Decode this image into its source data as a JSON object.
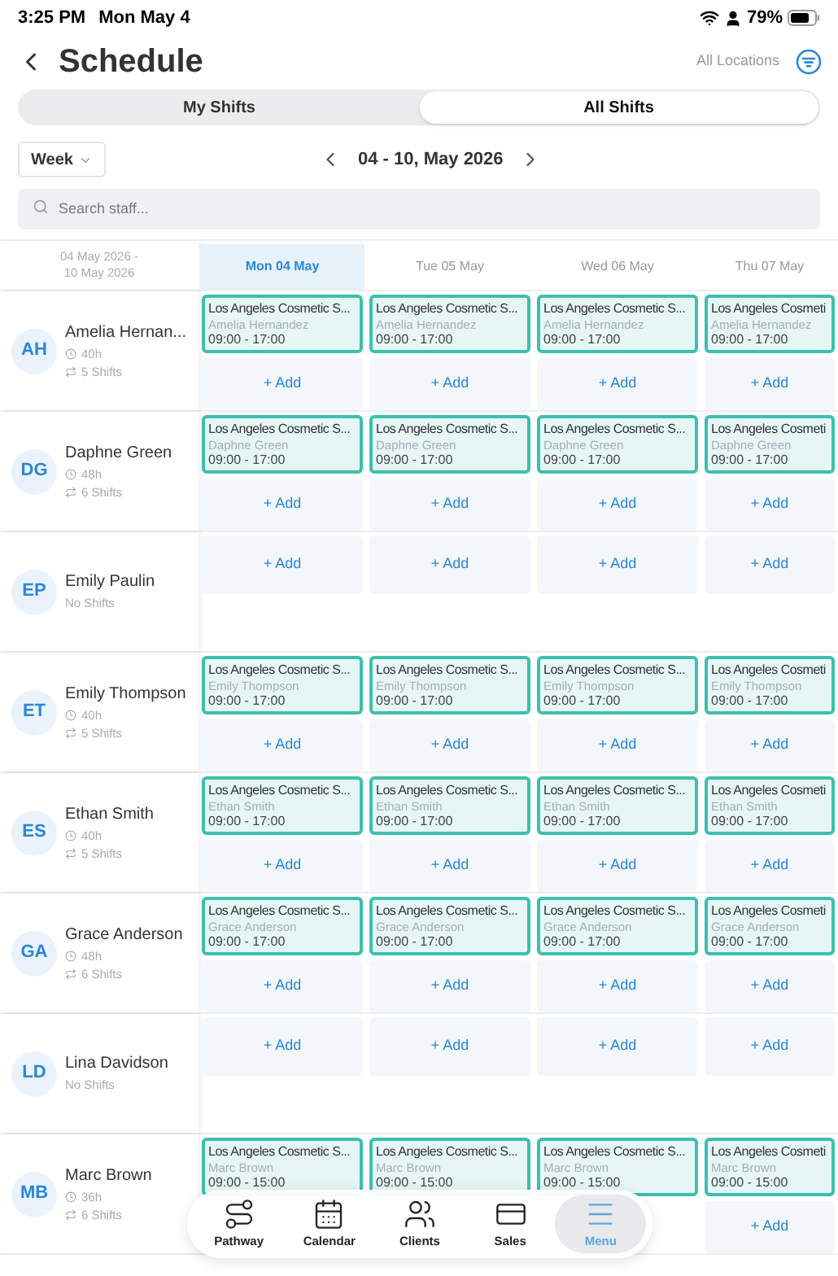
{
  "status_bar": {
    "time": "3:25 PM",
    "date": "Mon May 4",
    "battery": "79%"
  },
  "header": {
    "title": "Schedule",
    "location": "All Locations"
  },
  "tabs": [
    {
      "label": "My Shifts",
      "selected": false
    },
    {
      "label": "All Shifts",
      "selected": true
    }
  ],
  "period": {
    "view": "Week",
    "range": "04 - 10, May 2026"
  },
  "search": {
    "placeholder": "Search staff..."
  },
  "grid": {
    "range_label": "04 May 2026 - 10 May 2026",
    "days": [
      {
        "label": "Mon 04 May",
        "selected": true
      },
      {
        "label": "Tue 05 May",
        "selected": false
      },
      {
        "label": "Wed 06 May",
        "selected": false
      },
      {
        "label": "Thu 07 May",
        "selected": false
      }
    ],
    "staff": [
      {
        "initials": "AH",
        "name": "Amelia Hernan...",
        "hours": "40h",
        "shifts": "5 Shifts",
        "cells": [
          {
            "shift": {
              "title": "Los Angeles Cosmetic S...",
              "name": "Amelia Hernandez",
              "time": "09:00 - 17:00"
            },
            "add": "+ Add"
          },
          {
            "shift": {
              "title": "Los Angeles Cosmetic S...",
              "name": "Amelia Hernandez",
              "time": "09:00 - 17:00"
            },
            "add": "+ Add"
          },
          {
            "shift": {
              "title": "Los Angeles Cosmetic S...",
              "name": "Amelia Hernandez",
              "time": "09:00 - 17:00"
            },
            "add": "+ Add"
          },
          {
            "shift": {
              "title": "Los Angeles Cosmeti",
              "name": "Amelia Hernandez",
              "time": "09:00 - 17:00"
            },
            "add": "+ Add"
          }
        ]
      },
      {
        "initials": "DG",
        "name": "Daphne Green",
        "hours": "48h",
        "shifts": "6 Shifts",
        "cells": [
          {
            "shift": {
              "title": "Los Angeles Cosmetic S...",
              "name": "Daphne Green",
              "time": "09:00 - 17:00"
            },
            "add": "+ Add"
          },
          {
            "shift": {
              "title": "Los Angeles Cosmetic S...",
              "name": "Daphne Green",
              "time": "09:00 - 17:00"
            },
            "add": "+ Add"
          },
          {
            "shift": {
              "title": "Los Angeles Cosmetic S...",
              "name": "Daphne Green",
              "time": "09:00 - 17:00"
            },
            "add": "+ Add"
          },
          {
            "shift": {
              "title": "Los Angeles Cosmeti",
              "name": "Daphne Green",
              "time": "09:00 - 17:00"
            },
            "add": "+ Add"
          }
        ]
      },
      {
        "initials": "EP",
        "name": "Emily Paulin",
        "shifts": "No Shifts",
        "cells": [
          {
            "add": "+ Add"
          },
          {
            "add": "+ Add"
          },
          {
            "add": "+ Add"
          },
          {
            "add": "+ Add"
          }
        ]
      },
      {
        "initials": "ET",
        "name": "Emily Thompson",
        "hours": "40h",
        "shifts": "5 Shifts",
        "cells": [
          {
            "shift": {
              "title": "Los Angeles Cosmetic S...",
              "name": "Emily Thompson",
              "time": "09:00 - 17:00"
            },
            "add": "+ Add"
          },
          {
            "shift": {
              "title": "Los Angeles Cosmetic S...",
              "name": "Emily Thompson",
              "time": "09:00 - 17:00"
            },
            "add": "+ Add"
          },
          {
            "shift": {
              "title": "Los Angeles Cosmetic S...",
              "name": "Emily Thompson",
              "time": "09:00 - 17:00"
            },
            "add": "+ Add"
          },
          {
            "shift": {
              "title": "Los Angeles Cosmeti",
              "name": "Emily Thompson",
              "time": "09:00 - 17:00"
            },
            "add": "+ Add"
          }
        ]
      },
      {
        "initials": "ES",
        "name": "Ethan Smith",
        "hours": "40h",
        "shifts": "5 Shifts",
        "cells": [
          {
            "shift": {
              "title": "Los Angeles Cosmetic S...",
              "name": "Ethan Smith",
              "time": "09:00 - 17:00"
            },
            "add": "+ Add"
          },
          {
            "shift": {
              "title": "Los Angeles Cosmetic S...",
              "name": "Ethan Smith",
              "time": "09:00 - 17:00"
            },
            "add": "+ Add"
          },
          {
            "shift": {
              "title": "Los Angeles Cosmetic S...",
              "name": "Ethan Smith",
              "time": "09:00 - 17:00"
            },
            "add": "+ Add"
          },
          {
            "shift": {
              "title": "Los Angeles Cosmeti",
              "name": "Ethan Smith",
              "time": "09:00 - 17:00"
            },
            "add": "+ Add"
          }
        ]
      },
      {
        "initials": "GA",
        "name": "Grace Anderson",
        "hours": "48h",
        "shifts": "6 Shifts",
        "cells": [
          {
            "shift": {
              "title": "Los Angeles Cosmetic S...",
              "name": "Grace Anderson",
              "time": "09:00 - 17:00"
            },
            "add": "+ Add"
          },
          {
            "shift": {
              "title": "Los Angeles Cosmetic S...",
              "name": "Grace Anderson",
              "time": "09:00 - 17:00"
            },
            "add": "+ Add"
          },
          {
            "shift": {
              "title": "Los Angeles Cosmetic S...",
              "name": "Grace Anderson",
              "time": "09:00 - 17:00"
            },
            "add": "+ Add"
          },
          {
            "shift": {
              "title": "Los Angeles Cosmeti",
              "name": "Grace Anderson",
              "time": "09:00 - 17:00"
            },
            "add": "+ Add"
          }
        ]
      },
      {
        "initials": "LD",
        "name": "Lina Davidson",
        "shifts": "No Shifts",
        "cells": [
          {
            "add": "+ Add"
          },
          {
            "add": "+ Add"
          },
          {
            "add": "+ Add"
          },
          {
            "add": "+ Add"
          }
        ]
      },
      {
        "initials": "MB",
        "name": "Marc Brown",
        "hours": "36h",
        "shifts": "6 Shifts",
        "cells": [
          {
            "shift": {
              "title": "Los Angeles Cosmetic S...",
              "name": "Marc Brown",
              "time": "09:00 - 15:00"
            }
          },
          {
            "shift": {
              "title": "Los Angeles Cosmetic S...",
              "name": "Marc Brown",
              "time": "09:00 - 15:00"
            }
          },
          {
            "shift": {
              "title": "Los Angeles Cosmetic S...",
              "name": "Marc Brown",
              "time": "09:00 - 15:00"
            }
          },
          {
            "shift": {
              "title": "Los Angeles Cosmeti",
              "name": "Marc Brown",
              "time": "09:00 - 15:00"
            },
            "add": "+ Add"
          }
        ]
      }
    ]
  },
  "nav": [
    {
      "kind": "pathway",
      "label": "Pathway",
      "selected": false
    },
    {
      "kind": "calendar",
      "label": "Calendar",
      "selected": false
    },
    {
      "kind": "clients",
      "label": "Clients",
      "selected": false
    },
    {
      "kind": "sales",
      "label": "Sales",
      "selected": false
    },
    {
      "kind": "menu",
      "label": "Menu",
      "selected": true
    }
  ]
}
